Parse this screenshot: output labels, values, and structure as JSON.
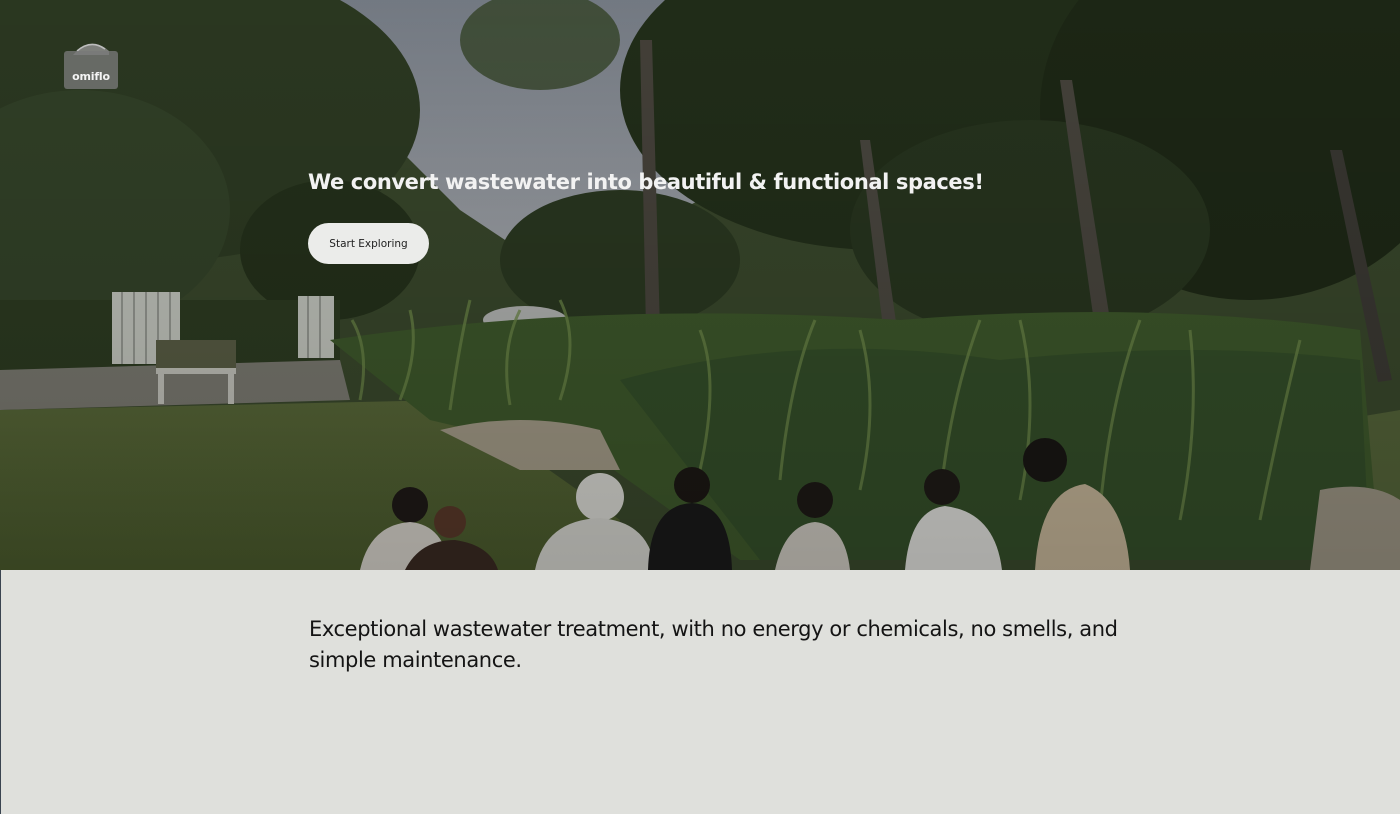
{
  "brand": {
    "logo_text": "omiflo"
  },
  "hero": {
    "title": "We convert wastewater into beautiful & functional spaces!",
    "cta_label": "Start Exploring"
  },
  "intro": {
    "tagline": "Exceptional wastewater treatment, with no energy or chemicals, no smells,  and simple maintenance."
  },
  "colors": {
    "content_background": "#dfe0dc",
    "cta_background": "#ebecea",
    "hero_text": "#f2f2f2",
    "body_text": "#141414"
  }
}
